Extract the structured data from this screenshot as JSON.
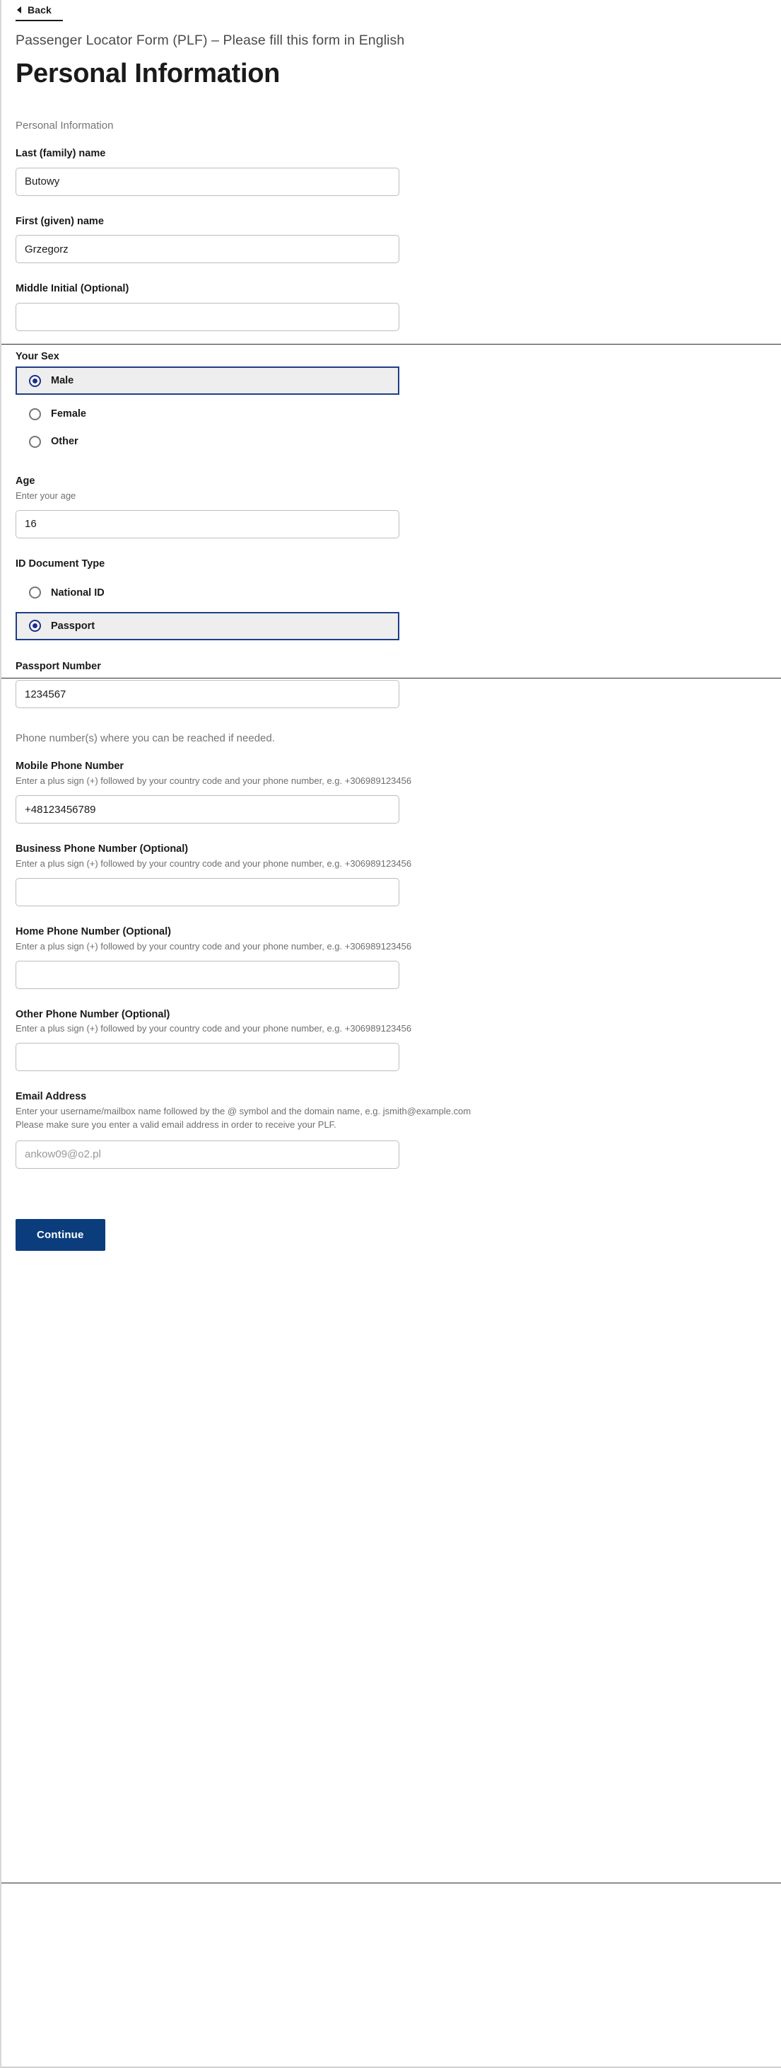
{
  "header": {
    "back_label": "Back",
    "subtitle": "Passenger Locator Form (PLF) – Please fill this form in English",
    "title": "Personal Information"
  },
  "form": {
    "section_legend": "Personal Information",
    "last_name": {
      "label": "Last (family) name",
      "value": "Butowy",
      "placeholder": ""
    },
    "first_name": {
      "label": "First (given) name",
      "value": "Grzegorz",
      "placeholder": ""
    },
    "middle_initial": {
      "label": "Middle Initial (Optional)",
      "value": "",
      "placeholder": ""
    },
    "sex": {
      "label": "Your Sex",
      "selected": "Male",
      "options": [
        {
          "label": "Male",
          "selected": true
        },
        {
          "label": "Female",
          "selected": false
        },
        {
          "label": "Other",
          "selected": false
        }
      ]
    },
    "age": {
      "label": "Age",
      "hint": "Enter your age",
      "value": "16",
      "placeholder": ""
    },
    "id_document_type": {
      "label": "ID Document Type",
      "selected": "Passport",
      "options": [
        {
          "label": "National ID",
          "selected": false
        },
        {
          "label": "Passport",
          "selected": true
        }
      ]
    },
    "passport_number": {
      "label": "Passport Number",
      "value": "1234567",
      "placeholder": ""
    },
    "phone_intro": "Phone number(s) where you can be reached if needed.",
    "phone_hint": "Enter a plus sign (+) followed by your country code and your phone number, e.g. +306989123456",
    "mobile_phone": {
      "label": "Mobile Phone Number",
      "value": "+48123456789",
      "placeholder": ""
    },
    "business_phone": {
      "label": "Business Phone Number (Optional)",
      "value": "",
      "placeholder": ""
    },
    "home_phone": {
      "label": "Home Phone Number (Optional)",
      "value": "",
      "placeholder": ""
    },
    "other_phone": {
      "label": "Other Phone Number (Optional)",
      "value": "",
      "placeholder": ""
    },
    "email": {
      "label": "Email Address",
      "hint_line1": "Enter your username/mailbox name followed by the @ symbol and the domain name, e.g. jsmith@example.com",
      "hint_line2": "Please make sure you enter a valid email address in order to receive your PLF.",
      "value": "",
      "placeholder": "ankow09@o2.pl"
    },
    "continue_label": "Continue"
  },
  "colors": {
    "accent": "#0b3d7c",
    "selected_border": "#1d3f86",
    "selected_bg": "#eeeeee",
    "radio_dot": "#1d2f8c",
    "hint_text": "#6f6f6f"
  }
}
